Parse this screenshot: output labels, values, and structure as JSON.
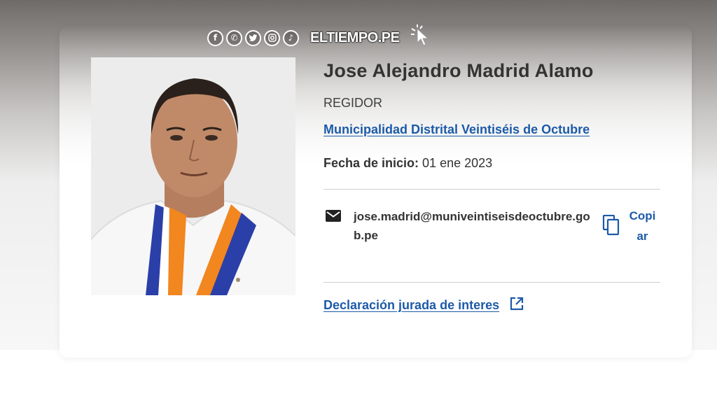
{
  "watermark": {
    "icons": [
      "facebook-icon",
      "whatsapp-icon",
      "twitter-icon",
      "instagram-icon",
      "tiktok-icon"
    ],
    "brand": "ELTIEMPO.PE"
  },
  "profile": {
    "name": "Jose Alejandro Madrid Alamo",
    "role": "REGIDOR",
    "organization": "Municipalidad Distrital Veintiséis de Octubre",
    "start_label": "Fecha de inicio:",
    "start_value": "01 ene 2023",
    "email": "jose.madrid@muniveintiseisdeoctubre.gob.pe",
    "copy_label": "Copiar",
    "declaration_link": "Declaración jurada de interes"
  },
  "colors": {
    "link": "#1d5aa8",
    "text": "#333333"
  }
}
